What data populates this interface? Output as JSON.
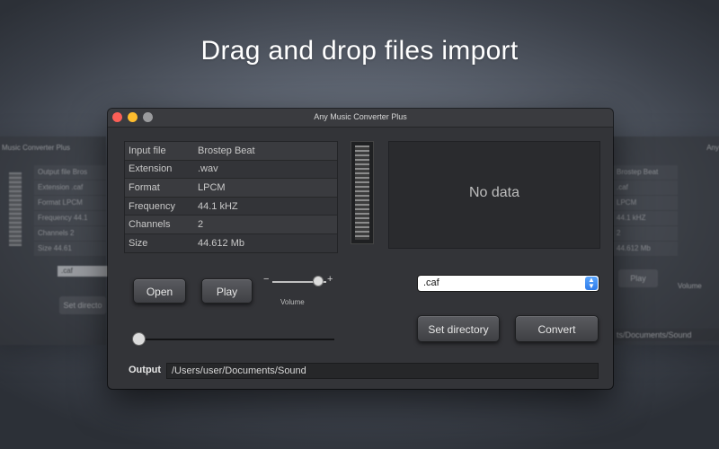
{
  "headline": "Drag and drop files import",
  "window": {
    "title": "Any Music Converter Plus"
  },
  "info_table": [
    {
      "label": "Input file",
      "value": "Brostep Beat"
    },
    {
      "label": "Extension",
      "value": ".wav"
    },
    {
      "label": "Format",
      "value": "LPCM"
    },
    {
      "label": "Frequency",
      "value": "44.1 kHZ"
    },
    {
      "label": "Channels",
      "value": "2"
    },
    {
      "label": "Size",
      "value": "44.612 Mb"
    }
  ],
  "preview": {
    "empty_text": "No data"
  },
  "controls": {
    "open_label": "Open",
    "play_label": "Play",
    "volume_minus": "−",
    "volume_plus": "+",
    "volume_label": "Volume",
    "volume_level": 0.85,
    "playback_position": 0.0
  },
  "format_select": {
    "selected": ".caf"
  },
  "actions": {
    "set_directory_label": "Set directory",
    "convert_label": "Convert"
  },
  "output": {
    "label": "Output",
    "path": "/Users/user/Documents/Sound"
  },
  "ghost_left": {
    "title": "Music Converter Plus",
    "rows": [
      "Output file   Bros",
      "Extension   .caf",
      "Format   LPCM",
      "Frequency   44.1",
      "Channels   2",
      "Size   44.61"
    ],
    "select": ".caf",
    "button": "Set directo"
  },
  "ghost_right": {
    "title": "Any",
    "rows": [
      "Brostep Beat",
      ".caf",
      "LPCM",
      "44.1 kHZ",
      "2",
      "44.612 Mb"
    ],
    "button": "Play",
    "volume": "Volume",
    "path": "ts/Documents/Sound"
  },
  "colors": {
    "close": "#fc5f57",
    "minimize": "#fdbc2e",
    "zoom": "#9a9b9d",
    "select_accent": "#2f7be8"
  }
}
